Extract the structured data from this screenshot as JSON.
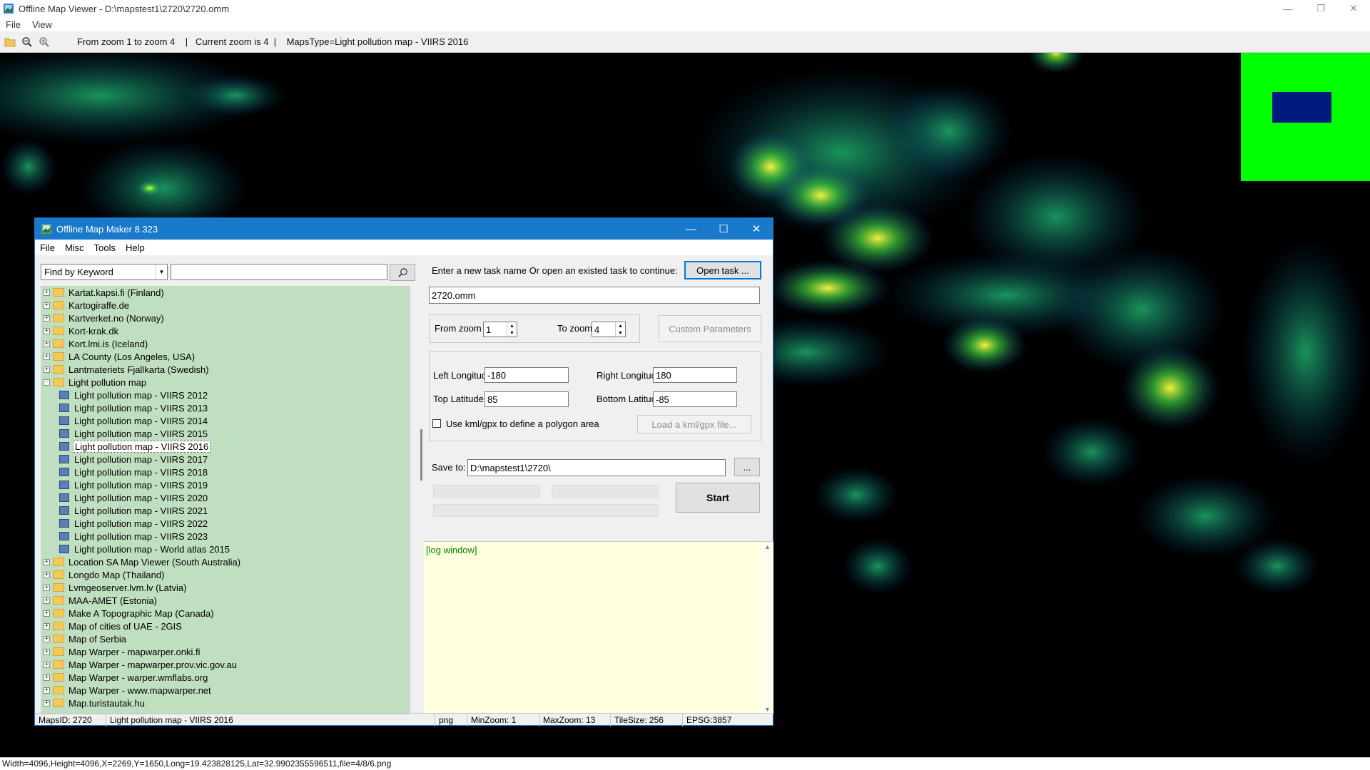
{
  "window": {
    "title": "Offline Map Viewer - D:\\mapstest1\\2720\\2720.omm",
    "menu": [
      "File",
      "View"
    ],
    "toolbar_info": "From zoom 1 to zoom 4    |   Current zoom is 4  |    MapsType=Light pollution map - VIIRS 2016",
    "status": "Width=4096,Height=4096,X=2269,Y=1650,Long=19.423828125,Lat=32.9902355596511,file=4/8/6.png"
  },
  "dialog": {
    "title": "Offline Map Maker 8.323",
    "menu": [
      "File",
      "Misc",
      "Tools",
      "Help"
    ],
    "search": {
      "combo_value": "Find by Keyword",
      "input_value": ""
    },
    "tree": [
      {
        "label": "Kartat.kapsi.fi (Finland)",
        "type": "folder",
        "expander": "+"
      },
      {
        "label": "Kartogiraffe.de",
        "type": "folder",
        "expander": "+"
      },
      {
        "label": "Kartverket.no (Norway)",
        "type": "folder",
        "expander": "+"
      },
      {
        "label": "Kort-krak.dk",
        "type": "folder",
        "expander": "+"
      },
      {
        "label": "Kort.lmi.is (Iceland)",
        "type": "folder",
        "expander": "+"
      },
      {
        "label": "LA County (Los Angeles, USA)",
        "type": "folder",
        "expander": "+"
      },
      {
        "label": "Lantmateriets Fjallkarta (Swedish)",
        "type": "folder",
        "expander": "+"
      },
      {
        "label": "Light pollution map",
        "type": "folder-open",
        "expander": "-"
      },
      {
        "label": "Light pollution map - VIIRS 2012",
        "type": "map"
      },
      {
        "label": "Light pollution map - VIIRS 2013",
        "type": "map"
      },
      {
        "label": "Light pollution map - VIIRS 2014",
        "type": "map"
      },
      {
        "label": "Light pollution map - VIIRS 2015",
        "type": "map"
      },
      {
        "label": "Light pollution map - VIIRS 2016",
        "type": "map",
        "selected": true
      },
      {
        "label": "Light pollution map - VIIRS 2017",
        "type": "map"
      },
      {
        "label": "Light pollution map - VIIRS 2018",
        "type": "map"
      },
      {
        "label": "Light pollution map - VIIRS 2019",
        "type": "map"
      },
      {
        "label": "Light pollution map - VIIRS 2020",
        "type": "map"
      },
      {
        "label": "Light pollution map - VIIRS 2021",
        "type": "map"
      },
      {
        "label": "Light pollution map - VIIRS 2022",
        "type": "map"
      },
      {
        "label": "Light pollution map - VIIRS 2023",
        "type": "map"
      },
      {
        "label": "Light pollution map - World atlas 2015",
        "type": "map"
      },
      {
        "label": "Location SA Map Viewer (South Australia)",
        "type": "folder",
        "expander": "+"
      },
      {
        "label": "Longdo Map (Thailand)",
        "type": "folder",
        "expander": "+"
      },
      {
        "label": "Lvmgeoserver.lvm.lv (Latvia)",
        "type": "folder",
        "expander": "+"
      },
      {
        "label": "MAA-AMET (Estonia)",
        "type": "folder",
        "expander": "+"
      },
      {
        "label": "Make A Topographic Map (Canada)",
        "type": "folder",
        "expander": "+"
      },
      {
        "label": "Map of cities of UAE - 2GIS",
        "type": "folder",
        "expander": "+"
      },
      {
        "label": "Map of Serbia",
        "type": "folder",
        "expander": "+"
      },
      {
        "label": "Map Warper - mapwarper.onki.fi",
        "type": "folder",
        "expander": "+"
      },
      {
        "label": "Map Warper - mapwarper.prov.vic.gov.au",
        "type": "folder",
        "expander": "+"
      },
      {
        "label": "Map Warper - warper.wmflabs.org",
        "type": "folder",
        "expander": "+"
      },
      {
        "label": "Map Warper - www.mapwarper.net",
        "type": "folder",
        "expander": "+"
      },
      {
        "label": "Map.turistautak.hu",
        "type": "folder",
        "expander": "+"
      }
    ],
    "task": {
      "prompt": "Enter a new task name Or open an existed task to continue:",
      "open_button": "Open task ...",
      "name_value": "2720.omm"
    },
    "zoom": {
      "from_label": "From zoom",
      "from_value": "1",
      "to_label": "To zoom",
      "to_value": "4",
      "custom_button": "Custom Parameters"
    },
    "bounds": {
      "left_label": "Left Longitude",
      "left_value": "-180",
      "right_label": "Right Longitude",
      "right_value": "180",
      "top_label": "Top Latitude",
      "top_value": "85",
      "bottom_label": "Bottom Latitude",
      "bottom_value": "-85",
      "kml_checkbox_label": "Use kml/gpx to define a polygon area",
      "kml_button": "Load a kml/gpx file..."
    },
    "save": {
      "label": "Save to:",
      "value": "D:\\mapstest1\\2720\\",
      "browse": "..."
    },
    "start_button": "Start",
    "log_text": "[log window]",
    "status": {
      "maps_id": "MapsID: 2720",
      "map_name": "Light pollution map - VIIRS 2016",
      "format": "png",
      "min_zoom": "MinZoom: 1",
      "max_zoom": "MaxZoom: 13",
      "tile_size": "TileSize: 256",
      "epsg": "EPSG:3857"
    }
  },
  "colors": {
    "dialog_titlebar": "#1979ca",
    "tree_background": "#c0dec0",
    "log_background": "#ffffe0",
    "log_text": "#008000",
    "map_background": "#000000",
    "corner_tile": "#00ff00",
    "corner_rect": "#001a80"
  }
}
